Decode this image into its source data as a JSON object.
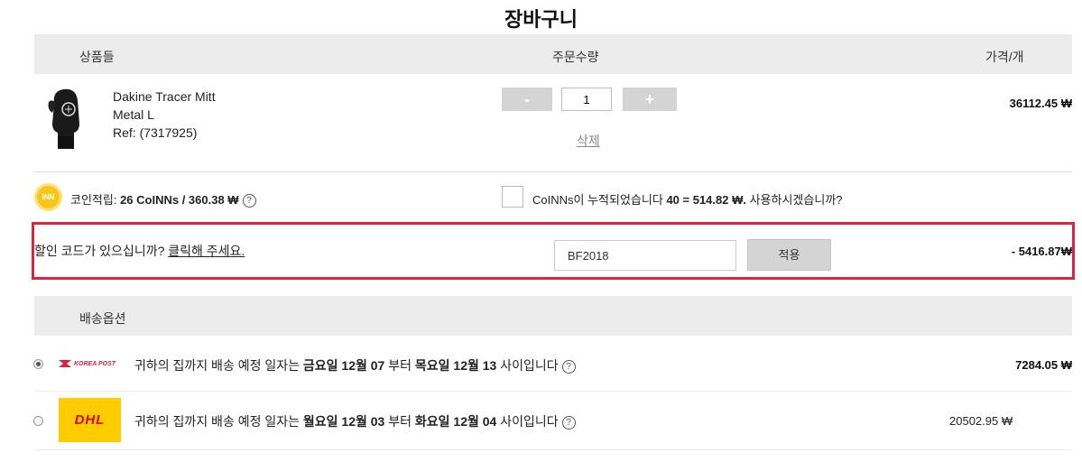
{
  "page": {
    "title": "장바구니"
  },
  "table_header": {
    "products": "상품들",
    "quantity": "주문수량",
    "price_per_unit": "가격/개"
  },
  "product": {
    "name": "Dakine Tracer Mitt",
    "variant": "Metal L",
    "ref": "Ref: (7317925)",
    "quantity": "1",
    "minus_label": "-",
    "plus_label": "+",
    "delete_label": "삭제",
    "price": "36112.45 ₩"
  },
  "coins": {
    "badge": "INN",
    "earn_label": "코인적립:",
    "earn_value": "26 CoINNs / 360.38 ₩",
    "accum_text": "CoINNs이 누적되었습니다",
    "accum_value": "40 = 514.82 ₩.",
    "use_question": "사용하시겠습니까?",
    "help": "?"
  },
  "coupon": {
    "question": "할인 코드가 있으십니까?",
    "link": "클릭해 주세요.",
    "code_value": "BF2018",
    "apply_label": "적용",
    "discount": "- 5416.87₩"
  },
  "shipping": {
    "header": "배송옵션",
    "options": [
      {
        "logo": "KOREA POST",
        "prefix": "귀하의 집까지 배송 예정 일자는",
        "from": "금요일 12월 07",
        "mid": "부터",
        "to": "목요일 12월 13",
        "suffix": "사이입니다",
        "price": "7284.05 ₩",
        "selected": true
      },
      {
        "logo": "DHL",
        "prefix": "귀하의 집까지 배송 예정 일자는",
        "from": "월요일 12월 03",
        "mid": "부터",
        "to": "화요일 12월 04",
        "suffix": "사이입니다",
        "price": "20502.95 ₩",
        "selected": false
      }
    ]
  },
  "colors": {
    "highlight": "#d8263b",
    "header_band": "#ececec",
    "coin": "#f6c61a",
    "dhl_yellow": "#ffcc00",
    "dhl_red": "#d40511"
  }
}
